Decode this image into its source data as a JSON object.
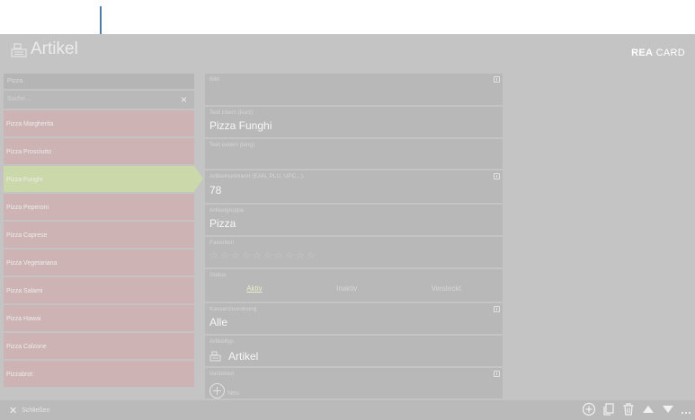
{
  "header": {
    "title": "Artikel",
    "title_icon": "register-icon",
    "brand_bold": "REA",
    "brand_rest": "CARD"
  },
  "list": {
    "category": "Pizza",
    "search_placeholder": "Suche...",
    "clear_symbol": "×",
    "items": [
      {
        "label": "Pizza Margherita",
        "selected": false
      },
      {
        "label": "Pizza Prosciutto",
        "selected": false
      },
      {
        "label": "Pizza Funghi",
        "selected": true
      },
      {
        "label": "Pizza Peperoni",
        "selected": false
      },
      {
        "label": "Pizza Caprese",
        "selected": false
      },
      {
        "label": "Pizza Vegetariana",
        "selected": false
      },
      {
        "label": "Pizza Salami",
        "selected": false
      },
      {
        "label": "Pizza Hawai",
        "selected": false
      },
      {
        "label": "Pizza Calzone",
        "selected": false
      },
      {
        "label": "Pizzabrot",
        "selected": false
      }
    ]
  },
  "form": {
    "bild_label": "Bild",
    "text_intern_label": "Text intern (kurz)",
    "text_intern_value": "Pizza Funghi",
    "text_extern_label": "Text extern (lang)",
    "artikelnummern_label": "Artikelnummern (EAN, PLU, UPC,..)",
    "artikelnummern_value": "78",
    "artikelgruppe_label": "Artikelgruppe",
    "artikelgruppe_value": "Pizza",
    "favoriten_label": "Favoriten",
    "favoriten_star_count": 10,
    "status_label": "Status",
    "status_options": [
      "Aktiv",
      "Inaktiv",
      "Versteckt"
    ],
    "status_selected": "Aktiv",
    "kassenzuordnung_label": "Kassenzuordnung",
    "kassenzuordnung_value": "Alle",
    "artikeltyp_label": "Artikeltyp",
    "artikeltyp_value": "Artikel",
    "varianten_label": "Varianten",
    "neu_label": "Neu"
  },
  "footer": {
    "close_symbol": "✕",
    "close_label": "Schließen",
    "tools": [
      "add-circle-icon",
      "copy-icon",
      "trash-icon",
      "arrow-up-icon",
      "arrow-down-icon",
      "more-icon"
    ]
  },
  "colors": {
    "background": "#c4c4c4",
    "selected_item": "#cbd8a9",
    "list_item": "#cdb3b3",
    "annotation_arrow": "#1a4f8a"
  }
}
